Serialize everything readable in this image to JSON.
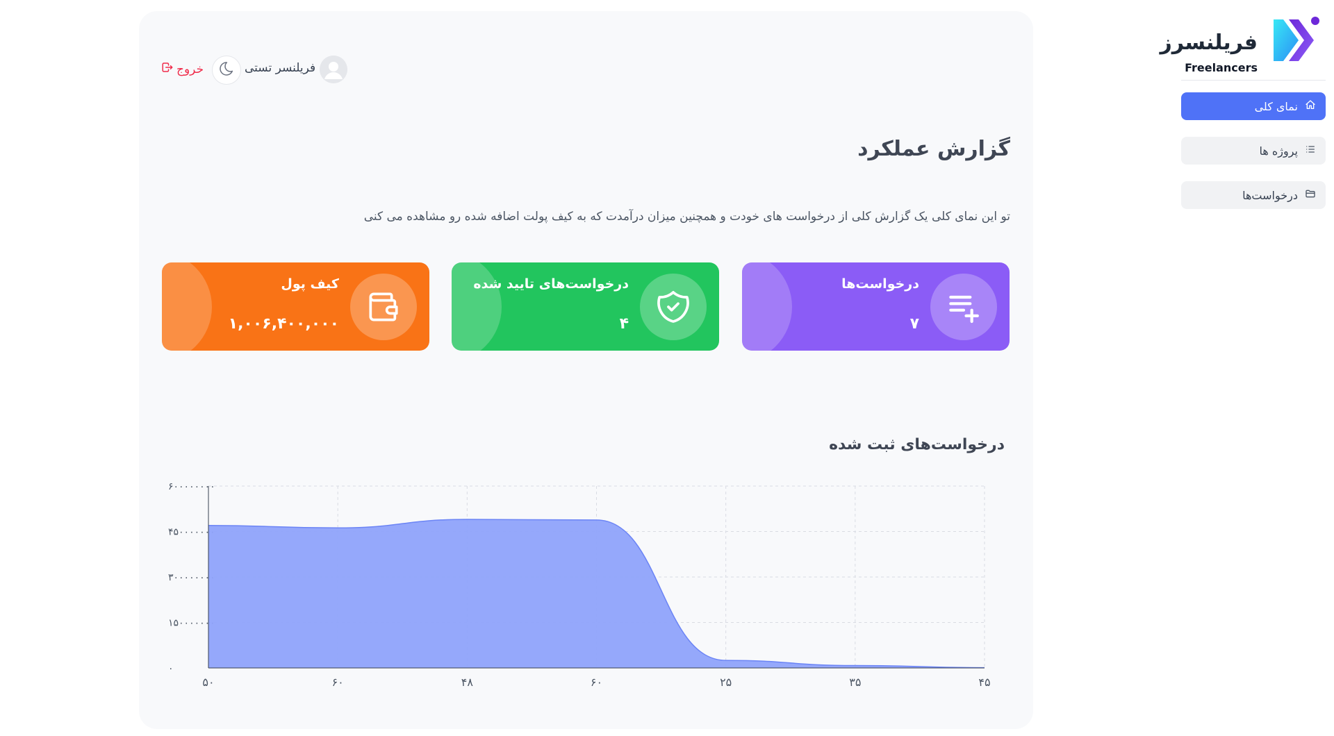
{
  "sidebar": {
    "logo_fa": "فریلنسرز",
    "logo_en": "Freelancers",
    "items": [
      {
        "label": "نمای کلی",
        "icon": "home-icon",
        "active": true
      },
      {
        "label": "پروژه ها",
        "icon": "list-icon",
        "active": false
      },
      {
        "label": "درخواست‌ها",
        "icon": "folder-icon",
        "active": false
      }
    ]
  },
  "header": {
    "user_name": "فریلنسر تستی",
    "logout_label": "خروج"
  },
  "page": {
    "title": "گزارش عملکرد",
    "description": "تو این نمای کلی یک گزارش کلی از درخواست های خودت و همچنین میزان درآمدت که به کیف پولت اضافه شده رو مشاهده می کنی"
  },
  "cards": [
    {
      "title": "کیف پول",
      "value": "۱,۰۰۶,۴۰۰,۰۰۰",
      "color": "#f97316",
      "icon": "wallet-icon"
    },
    {
      "title": "درخواست‌های تایید شده",
      "value": "۴",
      "color": "#22c55e",
      "icon": "shield-check-icon"
    },
    {
      "title": "درخواست‌ها",
      "value": "۷",
      "color": "#8b5cf6",
      "icon": "playlist-add-icon"
    }
  ],
  "colors": {
    "accent": "#4f72f7",
    "danger": "#ef2b4a",
    "chart_fill": "#8fa3fb",
    "chart_line": "#6b84f5"
  },
  "chart_data": {
    "type": "area",
    "title": "درخواست‌های ثبت شده",
    "categories": [
      "۵۰",
      "۶۰",
      "۴۸",
      "۶۰",
      "۲۵",
      "۳۵",
      "۴۵"
    ],
    "series": [
      {
        "values": [
          470000000,
          462000000,
          490000000,
          488000000,
          25000000,
          8000000,
          1000000
        ]
      }
    ],
    "yticks": [
      "۰",
      "۱۵۰۰۰۰۰۰۰",
      "۳۰۰۰۰۰۰۰۰",
      "۴۵۰۰۰۰۰۰۰",
      "۶۰۰۰۰۰۰۰۰"
    ],
    "ylim": [
      0,
      600000000
    ],
    "grid": true,
    "legend": "none"
  }
}
